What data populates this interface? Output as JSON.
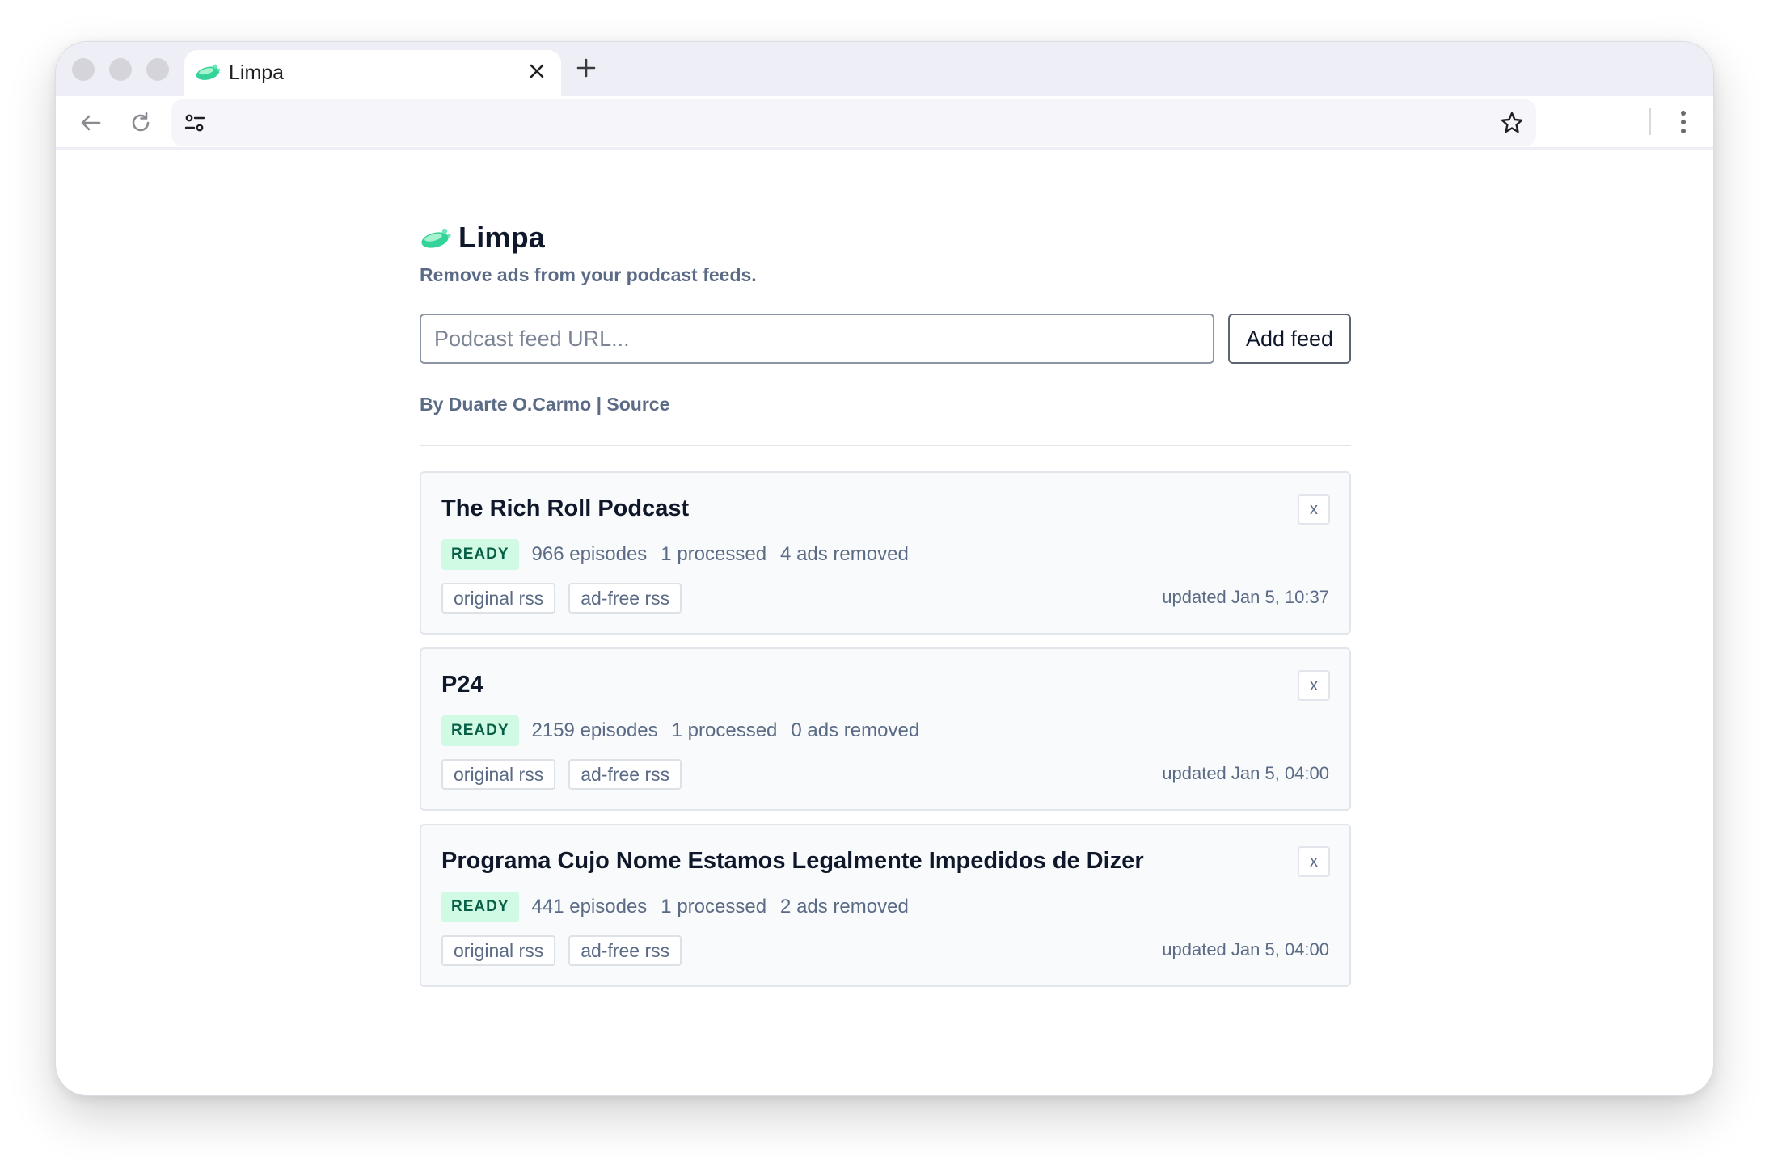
{
  "browser": {
    "tab_title": "Limpa",
    "url": ""
  },
  "colors": {
    "accent_green": "#34d399",
    "badge_bg": "#d1fae5",
    "badge_text": "#065f46",
    "muted_text": "#5b6b85"
  },
  "app": {
    "title": "Limpa",
    "tagline": "Remove ads from your podcast feeds.",
    "input_placeholder": "Podcast feed URL...",
    "add_button": "Add feed",
    "byline_prefix": "By",
    "author": "Duarte O.Carmo",
    "separator": "|",
    "source_link": "Source"
  },
  "feeds": [
    {
      "title": "The Rich Roll Podcast",
      "status": "READY",
      "episodes": "966 episodes",
      "processed": "1 processed",
      "ads_removed": "4 ads removed",
      "original_rss": "original rss",
      "adfree_rss": "ad-free rss",
      "updated": "updated Jan 5, 10:37",
      "remove_label": "x"
    },
    {
      "title": "P24",
      "status": "READY",
      "episodes": "2159 episodes",
      "processed": "1 processed",
      "ads_removed": "0 ads removed",
      "original_rss": "original rss",
      "adfree_rss": "ad-free rss",
      "updated": "updated Jan 5, 04:00",
      "remove_label": "x"
    },
    {
      "title": "Programa Cujo Nome Estamos Legalmente Impedidos de Dizer",
      "status": "READY",
      "episodes": "441 episodes",
      "processed": "1 processed",
      "ads_removed": "2 ads removed",
      "original_rss": "original rss",
      "adfree_rss": "ad-free rss",
      "updated": "updated Jan 5, 04:00",
      "remove_label": "x"
    }
  ]
}
